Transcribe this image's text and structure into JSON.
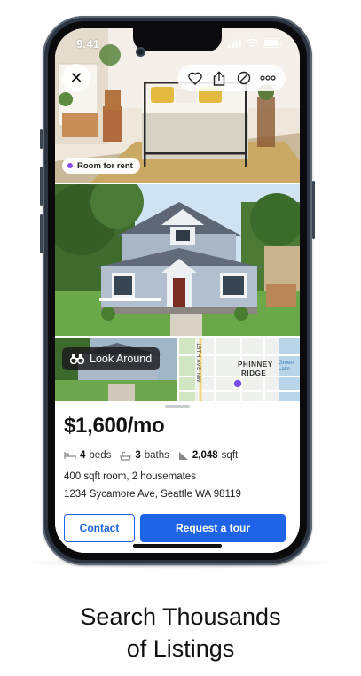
{
  "status_bar": {
    "time": "9:41"
  },
  "photos": {
    "tag_label": "Room for rent",
    "look_around_label": "Look Around",
    "map_label_1": "PHINNEY",
    "map_label_2": "RIDGE",
    "map_street": "15TH AVE NW",
    "map_water": "Green Lake"
  },
  "listing": {
    "price": "$1,600/mo",
    "beds_value": "4",
    "beds_label": "beds",
    "baths_value": "3",
    "baths_label": "baths",
    "sqft_value": "2,048",
    "sqft_label": "sqft",
    "description": "400 sqft room, 2 housemates",
    "address": "1234 Sycamore Ave, Seattle WA 98119"
  },
  "actions": {
    "contact_label": "Contact",
    "tour_label": "Request a tour"
  },
  "caption": {
    "line1": "Search Thousands",
    "line2": "of Listings"
  },
  "colors": {
    "accent": "#1f63e6",
    "tag_dot": "#8a4cf0",
    "map_pin": "#7b4ee6"
  },
  "icons": [
    "close-icon",
    "heart-icon",
    "share-icon",
    "hide-icon",
    "more-icon",
    "binoculars-icon",
    "bed-icon",
    "bath-icon",
    "sqft-icon"
  ]
}
